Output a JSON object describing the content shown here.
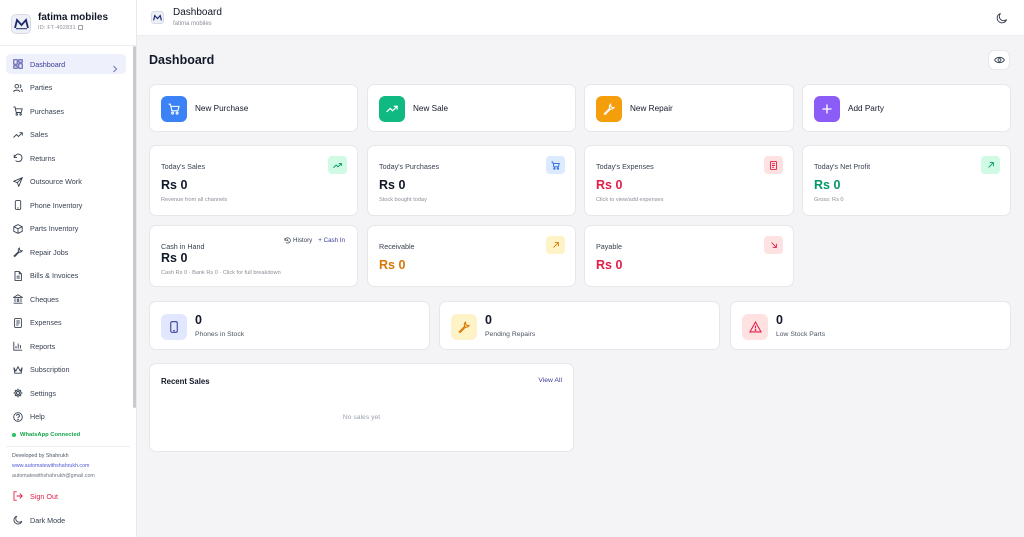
{
  "brand": {
    "name": "fatima mobiles",
    "id": "ID: FT-402831"
  },
  "sidebar": {
    "items": [
      {
        "label": "Dashboard",
        "icon": "dashboard-icon",
        "active": true
      },
      {
        "label": "Parties",
        "icon": "users-icon"
      },
      {
        "label": "Purchases",
        "icon": "cart-icon"
      },
      {
        "label": "Sales",
        "icon": "trend-up-icon"
      },
      {
        "label": "Returns",
        "icon": "return-icon"
      },
      {
        "label": "Outsource Work",
        "icon": "send-icon"
      },
      {
        "label": "Phone Inventory",
        "icon": "phone-icon"
      },
      {
        "label": "Parts Inventory",
        "icon": "box-icon"
      },
      {
        "label": "Repair Jobs",
        "icon": "wrench-icon"
      },
      {
        "label": "Bills & Invoices",
        "icon": "file-icon"
      },
      {
        "label": "Cheques",
        "icon": "bank-icon"
      },
      {
        "label": "Expenses",
        "icon": "receipt-icon"
      },
      {
        "label": "Reports",
        "icon": "bar-chart-icon"
      },
      {
        "label": "Subscription",
        "icon": "crown-icon"
      },
      {
        "label": "Settings",
        "icon": "gear-icon"
      },
      {
        "label": "Help",
        "icon": "help-icon"
      }
    ],
    "whatsapp": "WhatsApp Connected",
    "developed_by": "Developed by Shahrukh",
    "dev_link": "www.automatewithshahrukh.com",
    "dev_email": "automatewithshahrukh@gmail.com",
    "sign_out": "Sign Out",
    "dark_mode": "Dark Mode"
  },
  "header": {
    "title": "Dashboard",
    "subtitle": "fatima mobiles"
  },
  "page": {
    "title": "Dashboard"
  },
  "quick_actions": [
    {
      "label": "New Purchase",
      "color": "#3b82f6",
      "icon": "cart-icon"
    },
    {
      "label": "New Sale",
      "color": "#10b981",
      "icon": "trend-up-icon"
    },
    {
      "label": "New Repair",
      "color": "#f59e0b",
      "icon": "wrench-icon"
    },
    {
      "label": "Add Party",
      "color": "#8b5cf6",
      "icon": "plus-icon"
    }
  ],
  "stats": {
    "today_sales": {
      "title": "Today's Sales",
      "value": "Rs 0",
      "sub": "Revenue from all channels"
    },
    "today_purchases": {
      "title": "Today's Purchases",
      "value": "Rs 0",
      "sub": "Stock bought today"
    },
    "today_expenses": {
      "title": "Today's Expenses",
      "value": "Rs 0",
      "sub": "Click to view/add expenses"
    },
    "net_profit": {
      "title": "Today's Net Profit",
      "value": "Rs 0",
      "sub": "Gross: Rs 0"
    },
    "cash": {
      "title": "Cash in Hand",
      "value": "Rs 0",
      "sub": "Cash Rs 0 · Bank Rs 0 · Click for full breakdown",
      "history": "History",
      "cash_in": "+ Cash In"
    },
    "receivable": {
      "title": "Receivable",
      "value": "Rs 0"
    },
    "payable": {
      "title": "Payable",
      "value": "Rs 0"
    }
  },
  "mini": [
    {
      "value": "0",
      "label": "Phones in Stock"
    },
    {
      "value": "0",
      "label": "Pending Repairs"
    },
    {
      "value": "0",
      "label": "Low Stock Parts"
    }
  ],
  "recent_sales": {
    "title": "Recent Sales",
    "view_all": "View All",
    "empty": "No sales yet"
  },
  "colors": {
    "accent": "#3b3b9a",
    "green": "#059669",
    "red": "#e11d48",
    "orange": "#d97706"
  }
}
